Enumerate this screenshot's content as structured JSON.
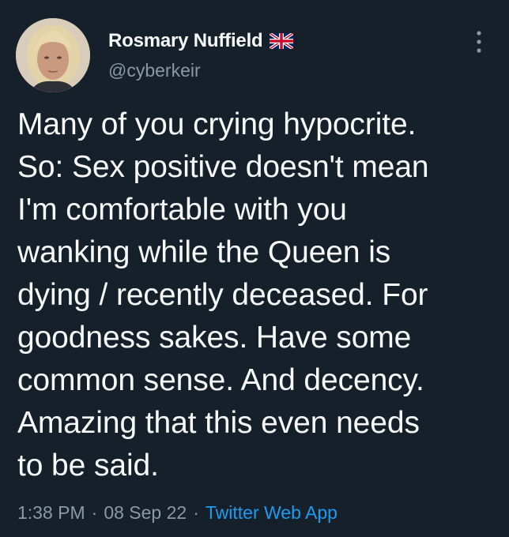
{
  "author": {
    "display_name": "Rosmary Nuffield",
    "handle": "@cyberkeir",
    "flag": "uk-flag-icon"
  },
  "tweet": {
    "text": "Many of you crying hypocrite.\nSo: Sex positive doesn't mean\nI'm comfortable with you\nwanking while the Queen is\ndying / recently deceased. For\ngoodness sakes. Have some\ncommon sense. And decency.\nAmazing that this even needs\nto be said.",
    "time": "1:38 PM",
    "separator": "·",
    "date": "08 Sep 22",
    "source": "Twitter Web App"
  },
  "colors": {
    "background": "#15202b",
    "text": "#f7f9f9",
    "secondary": "#8b98a5",
    "link": "#1d9bf0"
  }
}
